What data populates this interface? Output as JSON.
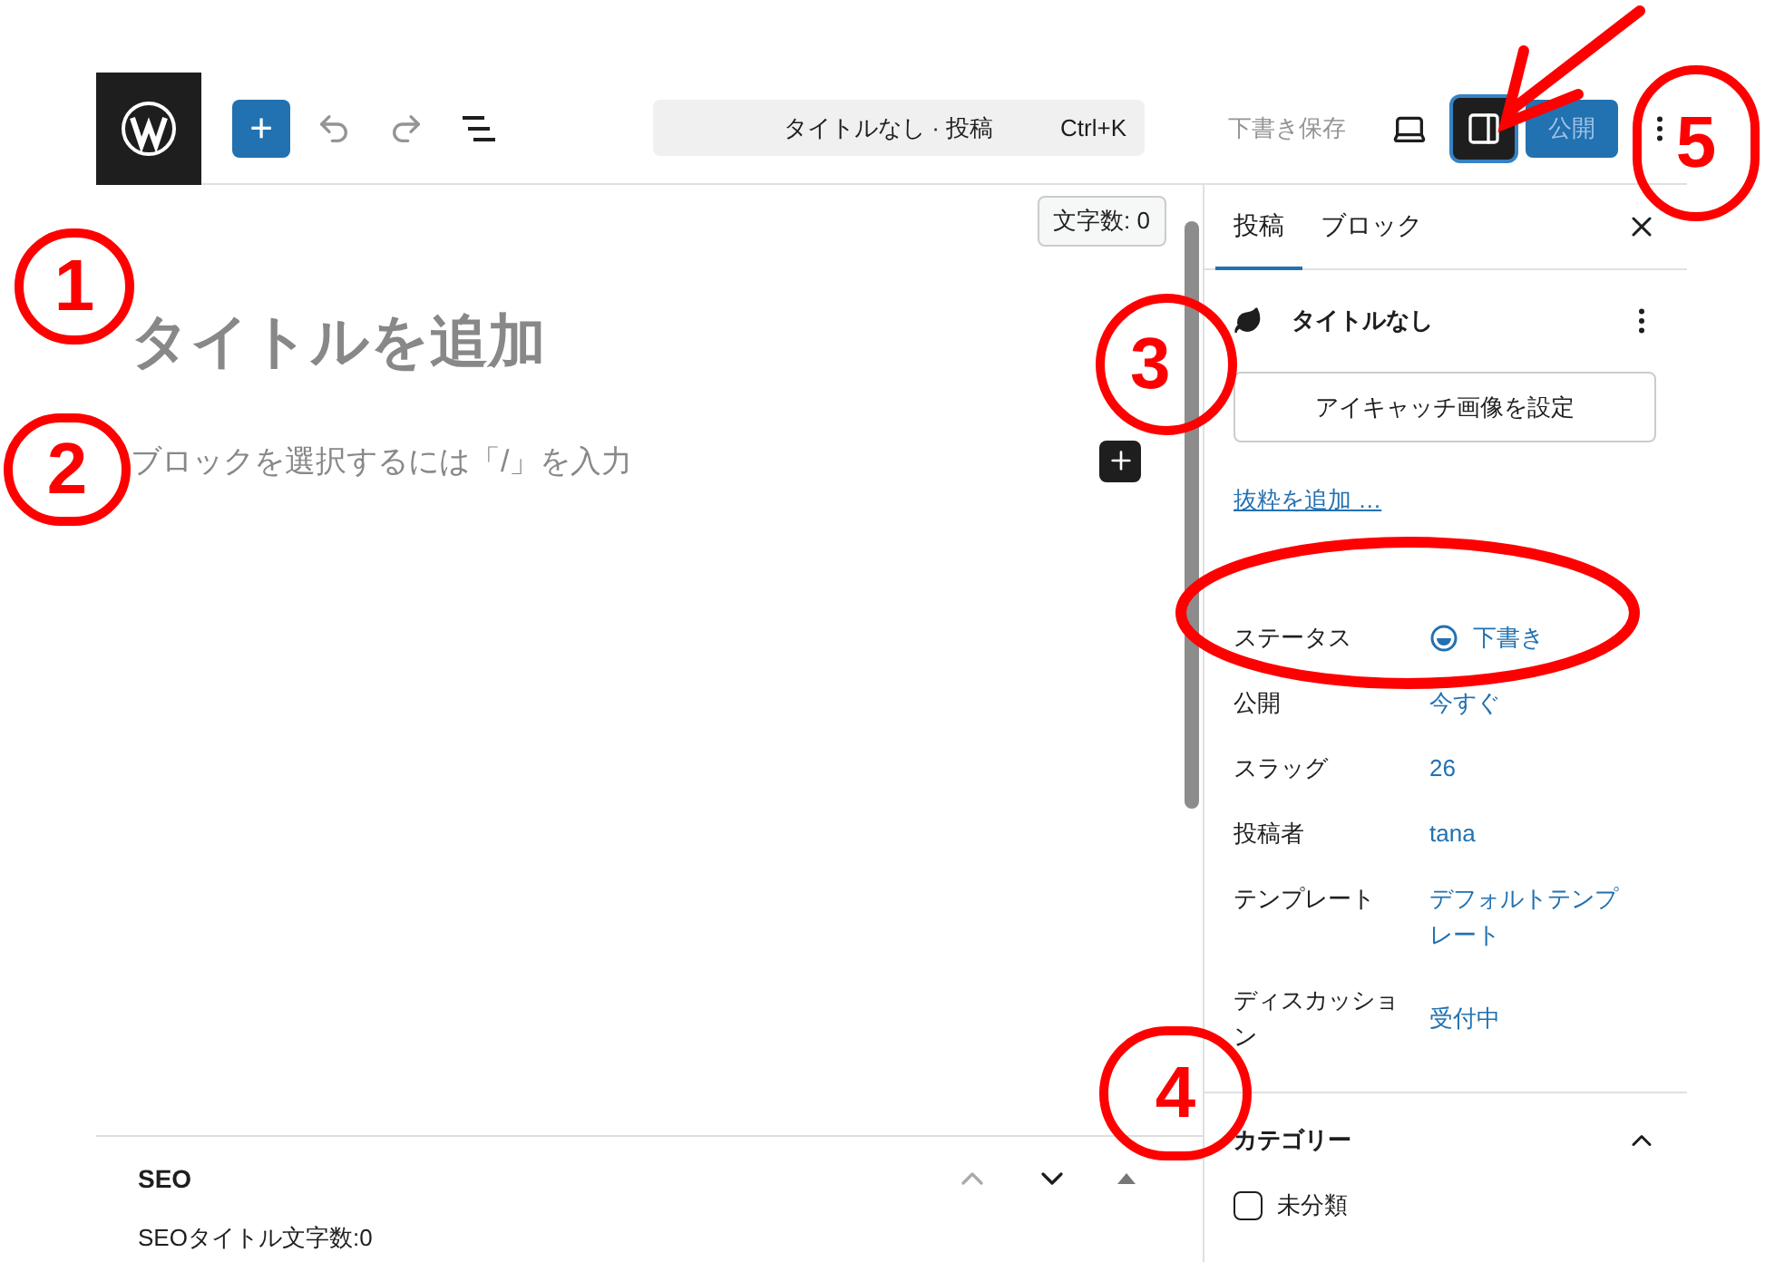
{
  "toolbar": {
    "add_label": "+",
    "undo": {
      "disabled": true
    },
    "redo": {
      "disabled": true
    },
    "command_bar": {
      "title": "タイトルなし · 投稿",
      "shortcut": "Ctrl+K"
    },
    "save_draft": "下書き保存",
    "settings_toggle": {
      "selected": true
    },
    "publish": {
      "label": "公開",
      "disabled": true
    }
  },
  "editor": {
    "word_count": "文字数: 0",
    "title_placeholder": "タイトルを追加",
    "block_placeholder": "ブロックを選択するには「/」を入力"
  },
  "seo_panel": {
    "title": "SEO",
    "field": "SEOタイトル文字数:0"
  },
  "sidebar": {
    "tabs": [
      {
        "label": "投稿",
        "selected": true
      },
      {
        "label": "ブロック",
        "selected": false
      }
    ],
    "post_title": "タイトルなし",
    "featured_image_button": "アイキャッチ画像を設定",
    "excerpt_link": "抜粋を追加 …",
    "rows": [
      {
        "kind": "status",
        "label": "ステータス",
        "value": "下書き"
      },
      {
        "kind": "text",
        "label": "公開",
        "value": "今すぐ"
      },
      {
        "kind": "text",
        "label": "スラッグ",
        "value": "26"
      },
      {
        "kind": "text",
        "label": "投稿者",
        "value": "tana"
      },
      {
        "kind": "text",
        "label": "テンプレート",
        "value": "デフォルトテンプレート"
      },
      {
        "kind": "text",
        "label": "ディスカッション",
        "value": "受付中"
      }
    ],
    "category_panel": {
      "title": "カテゴリー",
      "expanded": true,
      "items": [
        {
          "label": "未分類",
          "checked": false
        }
      ]
    }
  },
  "annotations": [
    {
      "kind": "circled_number",
      "label": "1"
    },
    {
      "kind": "circled_number",
      "label": "2"
    },
    {
      "kind": "circled_number",
      "label": "3"
    },
    {
      "kind": "circled_number",
      "label": "4"
    },
    {
      "kind": "circled_number",
      "label": "5"
    },
    {
      "kind": "ellipse"
    },
    {
      "kind": "arrow"
    }
  ]
}
